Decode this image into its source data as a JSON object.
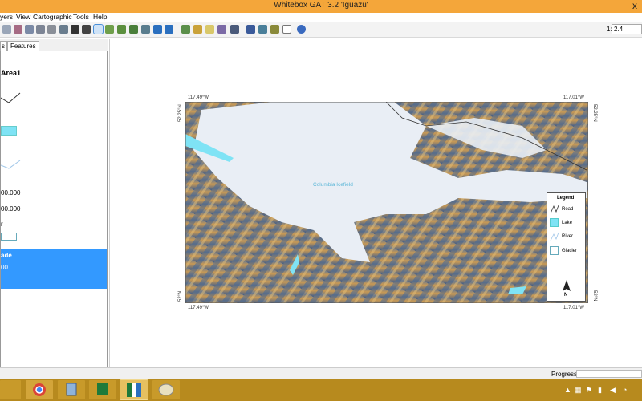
{
  "window": {
    "title": "Whitebox GAT 3.2 'Iguazu'",
    "close_glyph": "x"
  },
  "menu": {
    "items": [
      "yers",
      "View",
      "Cartographic",
      "Tools",
      "Help"
    ]
  },
  "toolbar": {
    "scale_label": "1:",
    "scale_value": "2.4",
    "icons": [
      "new-map-icon",
      "open-icon",
      "save-icon",
      "save-as-icon",
      "print-icon",
      "select-icon",
      "select-query-icon",
      "pan-icon",
      "zoom-in-icon",
      "zoom-out-icon",
      "zoom-extent-icon",
      "zoom-layer-icon",
      "back-icon",
      "forward-icon",
      "add-layer-icon",
      "open-layer-icon",
      "layer-icon",
      "remove-layer-icon",
      "print-map-icon",
      "table-icon",
      "histogram-icon",
      "ruler-icon",
      "profile-icon",
      "help-icon"
    ]
  },
  "left_panel": {
    "tabs": [
      "s",
      "Features"
    ],
    "layer_title": "Area1",
    "value_1": "00.000",
    "value_2": "00.000",
    "label_r": "r",
    "selected_title": "ade",
    "selected_value": "00"
  },
  "map": {
    "top_left_lon": "117.49°W",
    "top_right_lon": "117.01°W",
    "bottom_left_lon": "117.49°W",
    "bottom_right_lon": "117.01°W",
    "left_top_lat": "52.25°N",
    "left_bottom_lat": "52°N",
    "right_top_lat": "52.25°N",
    "right_bottom_lat": "52°N",
    "feature_label": "Columbia Icefield",
    "legend": {
      "title": "Legend",
      "items": [
        "Road",
        "Lake",
        "River",
        "Glacier"
      ]
    },
    "north_label": "N",
    "colors": {
      "glacier": "#e9eef5",
      "lake": "#7fe3f5",
      "terrain_dark": "#3a5a8c",
      "terrain_light": "#d9a85e"
    }
  },
  "status": {
    "progress_label": "Progress"
  },
  "taskbar": {
    "apps": [
      "file-explorer-icon",
      "chrome-icon",
      "virtualbox-icon",
      "excel-icon",
      "whitebox-icon",
      "paint-icon"
    ],
    "tray_icons": [
      "chevron-up-icon",
      "network-icon",
      "flag-icon",
      "battery-icon",
      "speaker-icon",
      "wifi-icon"
    ]
  }
}
